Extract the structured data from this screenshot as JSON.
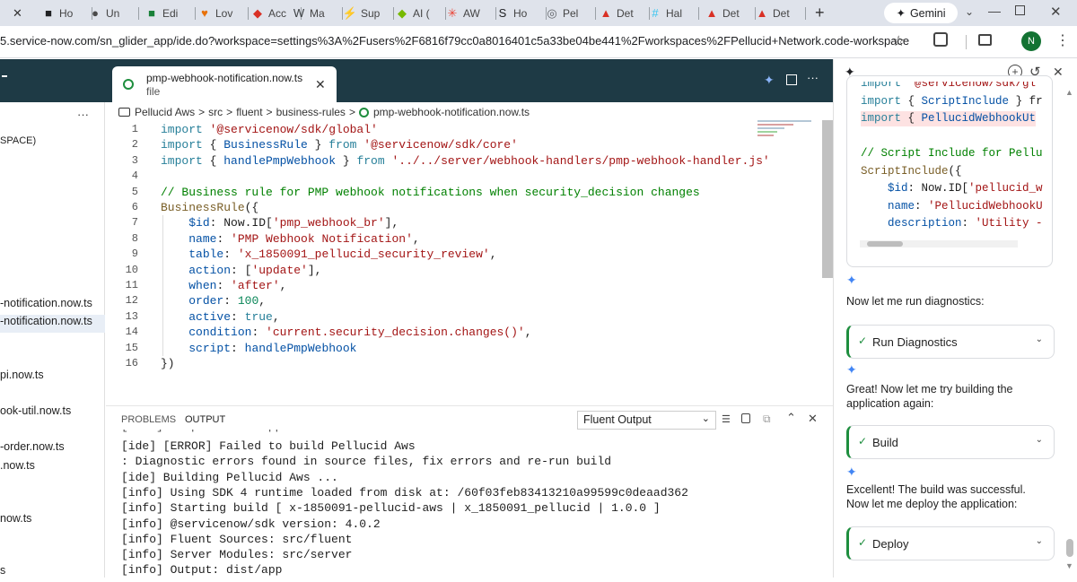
{
  "browser": {
    "tabs": [
      {
        "label": "Ho",
        "color": "#202124",
        "glyph": "■"
      },
      {
        "label": "Un",
        "color": "#4a4a4a",
        "glyph": "●"
      },
      {
        "label": "Edi",
        "color": "#188038",
        "glyph": "■"
      },
      {
        "label": "Lov",
        "color": "#e8710a",
        "glyph": "♥"
      },
      {
        "label": "Acc",
        "color": "#d93025",
        "glyph": "◆"
      },
      {
        "label": "Ma",
        "color": "#3c4043",
        "glyph": "W"
      },
      {
        "label": "Sup",
        "color": "#34a853",
        "glyph": "⚡"
      },
      {
        "label": "AI (",
        "color": "#76b900",
        "glyph": "◆"
      },
      {
        "label": "AW",
        "color": "#ea4335",
        "glyph": "✳"
      },
      {
        "label": "Ho",
        "color": "#202124",
        "glyph": "S"
      },
      {
        "label": "Pel",
        "color": "#5f6368",
        "glyph": "◎"
      },
      {
        "label": "Det",
        "color": "#d93025",
        "glyph": "▲"
      },
      {
        "label": "Hal",
        "color": "#36c5f0",
        "glyph": "#"
      },
      {
        "label": "Det",
        "color": "#d93025",
        "glyph": "▲"
      },
      {
        "label": "Det",
        "color": "#d93025",
        "glyph": "▲"
      }
    ],
    "new_tab": "+",
    "gemini_label": "Gemini",
    "url": "5.service-now.com/sn_glider_app/ide.do?workspace=settings%3A%2Fusers%2F6816f79cc0a8016401c5a33be04be441%2Fworkspaces%2FPellucid+Network.code-workspace",
    "profile_initial": "N"
  },
  "ide": {
    "tab": {
      "filename": "pmp-webhook-notification.now.ts",
      "subtitle": "file"
    },
    "breadcrumb": [
      "Pellucid Aws",
      "src",
      "fluent",
      "business-rules",
      "pmp-webhook-notification.now.ts"
    ],
    "sidebar_items": [
      {
        "label": "SPACE)"
      },
      {
        "label": "-notification.now.ts"
      },
      {
        "label": "-notification.now.ts"
      },
      {
        "label": "pi.now.ts"
      },
      {
        "label": "ook-util.now.ts"
      },
      {
        "label": "-order.now.ts"
      },
      {
        "label": ".now.ts"
      },
      {
        "label": "now.ts"
      },
      {
        "label": "s"
      }
    ],
    "sidebar_menu": "···",
    "code_lines": [
      {
        "n": "1",
        "parts": [
          [
            "kw",
            "import "
          ],
          [
            "st",
            "'@servicenow/sdk/global'"
          ]
        ]
      },
      {
        "n": "2",
        "parts": [
          [
            "kw",
            "import "
          ],
          [
            "df",
            "{ "
          ],
          [
            "pr",
            "BusinessRule"
          ],
          [
            "df",
            " } "
          ],
          [
            "kw",
            "from "
          ],
          [
            "st",
            "'@servicenow/sdk/core'"
          ]
        ]
      },
      {
        "n": "3",
        "parts": [
          [
            "kw",
            "import "
          ],
          [
            "df",
            "{ "
          ],
          [
            "pr",
            "handlePmpWebhook"
          ],
          [
            "df",
            " } "
          ],
          [
            "kw",
            "from "
          ],
          [
            "st",
            "'../../server/webhook-handlers/pmp-webhook-handler.js'"
          ]
        ]
      },
      {
        "n": "4",
        "parts": []
      },
      {
        "n": "5",
        "parts": [
          [
            "cm",
            "// Business rule for PMP webhook notifications when security_decision changes"
          ]
        ]
      },
      {
        "n": "6",
        "parts": [
          [
            "fn",
            "BusinessRule"
          ],
          [
            "df",
            "({"
          ]
        ]
      },
      {
        "n": "7",
        "parts": [
          [
            "df",
            "    "
          ],
          [
            "pr",
            "$id"
          ],
          [
            "df",
            ": Now.ID["
          ],
          [
            "st",
            "'pmp_webhook_br'"
          ],
          [
            "df",
            "],"
          ]
        ]
      },
      {
        "n": "8",
        "parts": [
          [
            "df",
            "    "
          ],
          [
            "pr",
            "name"
          ],
          [
            "df",
            ": "
          ],
          [
            "st",
            "'PMP Webhook Notification'"
          ],
          [
            "df",
            ","
          ]
        ]
      },
      {
        "n": "9",
        "parts": [
          [
            "df",
            "    "
          ],
          [
            "pr",
            "table"
          ],
          [
            "df",
            ": "
          ],
          [
            "st",
            "'x_1850091_pellucid_security_review'"
          ],
          [
            "df",
            ","
          ]
        ]
      },
      {
        "n": "10",
        "parts": [
          [
            "df",
            "    "
          ],
          [
            "pr",
            "action"
          ],
          [
            "df",
            ": ["
          ],
          [
            "st",
            "'update'"
          ],
          [
            "df",
            "],"
          ]
        ]
      },
      {
        "n": "11",
        "parts": [
          [
            "df",
            "    "
          ],
          [
            "pr",
            "when"
          ],
          [
            "df",
            ": "
          ],
          [
            "st",
            "'after'"
          ],
          [
            "df",
            ","
          ]
        ]
      },
      {
        "n": "12",
        "parts": [
          [
            "df",
            "    "
          ],
          [
            "pr",
            "order"
          ],
          [
            "df",
            ": "
          ],
          [
            "nb",
            "100"
          ],
          [
            "df",
            ","
          ]
        ]
      },
      {
        "n": "13",
        "parts": [
          [
            "df",
            "    "
          ],
          [
            "pr",
            "active"
          ],
          [
            "df",
            ": "
          ],
          [
            "kw",
            "true"
          ],
          [
            "df",
            ","
          ]
        ]
      },
      {
        "n": "14",
        "parts": [
          [
            "df",
            "    "
          ],
          [
            "pr",
            "condition"
          ],
          [
            "df",
            ": "
          ],
          [
            "st",
            "'current.security_decision.changes()'"
          ],
          [
            "df",
            ","
          ]
        ]
      },
      {
        "n": "15",
        "parts": [
          [
            "df",
            "    "
          ],
          [
            "pr",
            "script"
          ],
          [
            "df",
            ": "
          ],
          [
            "pr",
            "handlePmpWebhook"
          ]
        ]
      },
      {
        "n": "16",
        "parts": [
          [
            "df",
            "})"
          ]
        ]
      }
    ],
    "panel_tabs": {
      "problems": "PROBLEMS",
      "output": "OUTPUT"
    },
    "output_select": "Fluent Output",
    "output_lines": [
      "[ide] [ERROR] Failed to build Pellucid Aws",
      ": Diagnostic errors found in source files, fix errors and re-run build",
      "[ide] Building Pellucid Aws ...",
      "[info] Using SDK 4 runtime loaded from disk at: /60f03feb83413210a99599c0deaad362",
      "[info] Starting build [ x-1850091-pellucid-aws | x_1850091_pellucid | 1.0.0 ]",
      "[info] @servicenow/sdk version: 4.0.2",
      "[info] Fluent Sources: src/fluent",
      "[info] Server Modules: src/server",
      "[info] Output: dist/app"
    ]
  },
  "gemini": {
    "code_snippet": [
      {
        "parts": [
          [
            "kw",
            "import "
          ],
          [
            "st",
            "'@servicenow/sdk/gl"
          ]
        ]
      },
      {
        "parts": [
          [
            "kw",
            "import "
          ],
          [
            "df",
            "{ "
          ],
          [
            "pr",
            "ScriptInclude"
          ],
          [
            "df",
            " } fr"
          ]
        ]
      },
      {
        "parts": [
          [
            "kw",
            "import "
          ],
          [
            "df",
            "{ "
          ],
          [
            "pr",
            "PellucidWebhookUt"
          ]
        ]
      },
      {
        "parts": []
      },
      {
        "parts": [
          [
            "cm",
            "// Script Include for Pellu"
          ]
        ]
      },
      {
        "parts": [
          [
            "fn",
            "ScriptInclude"
          ],
          [
            "df",
            "({"
          ]
        ]
      },
      {
        "parts": [
          [
            "df",
            "    "
          ],
          [
            "pr",
            "$id"
          ],
          [
            "df",
            ": Now.ID["
          ],
          [
            "st",
            "'pellucid_w"
          ]
        ]
      },
      {
        "parts": [
          [
            "df",
            "    "
          ],
          [
            "pr",
            "name"
          ],
          [
            "df",
            ": "
          ],
          [
            "st",
            "'PellucidWebhookU"
          ]
        ]
      },
      {
        "parts": [
          [
            "df",
            "    "
          ],
          [
            "pr",
            "description"
          ],
          [
            "df",
            ": "
          ],
          [
            "st",
            "'Utility -"
          ]
        ]
      }
    ],
    "messages": [
      {
        "text": "Now let me run diagnostics:",
        "card": "Run Diagnostics"
      },
      {
        "text": "Great! Now let me try building the application again:",
        "card": "Build"
      },
      {
        "text": "Excellent! The build was successful. Now let me deploy the application:",
        "card": "Deploy"
      }
    ]
  }
}
